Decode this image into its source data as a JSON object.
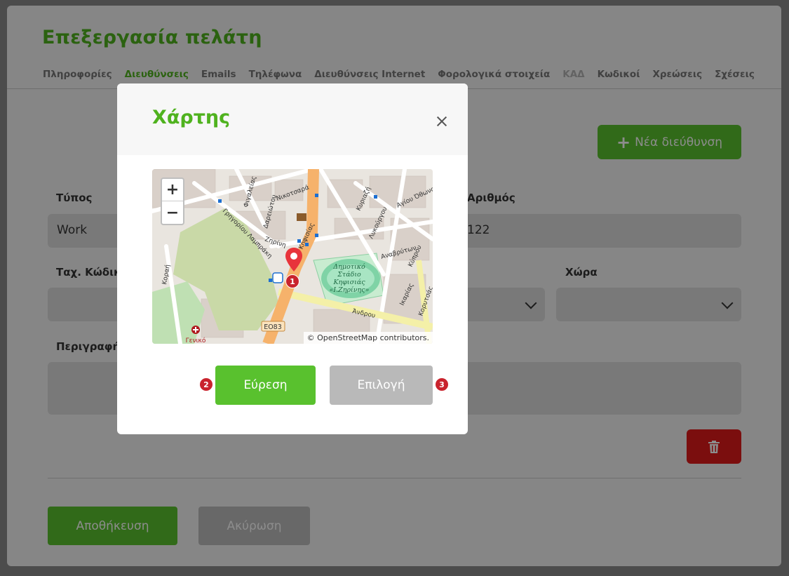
{
  "page": {
    "title": "Επεξεργασία πελάτη",
    "tabs": [
      {
        "label": "Πληροφορίες",
        "state": "normal"
      },
      {
        "label": "Διευθύνσεις",
        "state": "active"
      },
      {
        "label": "Emails",
        "state": "normal"
      },
      {
        "label": "Τηλέφωνα",
        "state": "normal"
      },
      {
        "label": "Διευθύνσεις Internet",
        "state": "normal"
      },
      {
        "label": "Φορολογικά στοιχεία",
        "state": "normal"
      },
      {
        "label": "ΚΑΔ",
        "state": "disabled"
      },
      {
        "label": "Κωδικοί",
        "state": "normal"
      },
      {
        "label": "Χρεώσεις",
        "state": "normal"
      },
      {
        "label": "Σχέσεις",
        "state": "normal"
      }
    ],
    "new_address_button": "Νέα διεύθυνση",
    "fields": {
      "type_label": "Τύπος",
      "type_value": "Work",
      "number_label": "Αριθμός",
      "number_value": "122",
      "postal_label": "Ταχ. Κώδικα",
      "country_label": "Χώρα",
      "description_label": "Περιγραφή"
    },
    "save_button": "Αποθήκευση",
    "cancel_button": "Ακύρωση"
  },
  "modal": {
    "title": "Χάρτης",
    "zoom_in": "+",
    "zoom_out": "−",
    "attribution": "© OpenStreetMap contributors.",
    "find_button": "Εύρεση",
    "select_button": "Επιλογή",
    "badges": [
      "1",
      "2",
      "3"
    ],
    "map_labels": {
      "stadium": [
        "Δημοτικό",
        "Στάδιο",
        "Κηφισιάς",
        "«Ι.Ζηρίνης»"
      ],
      "road_ref": "ΕΟ83",
      "hospital": "Γενικό",
      "streets": [
        "Κηφισίας",
        "Ζηρίνη",
        "Άνδρου",
        "Γρηγορίου Λαμπράκη",
        "Νικοτσαρά",
        "Αγίου Όθωνος",
        "Κυριαζή",
        "Λυκούργου",
        "Αναβρύτων",
        "Κύπρου",
        "Ικαρίας",
        "Κορυτσάς",
        "Δαρειώτου",
        "Φιγαλείας",
        "Κοραή"
      ]
    }
  },
  "colors": {
    "brand_green": "#59c12e",
    "title_green": "#4fb21e",
    "danger_red": "#e01b1b",
    "badge_red": "#c9232d",
    "disabled_gray": "#b9b9b9"
  }
}
